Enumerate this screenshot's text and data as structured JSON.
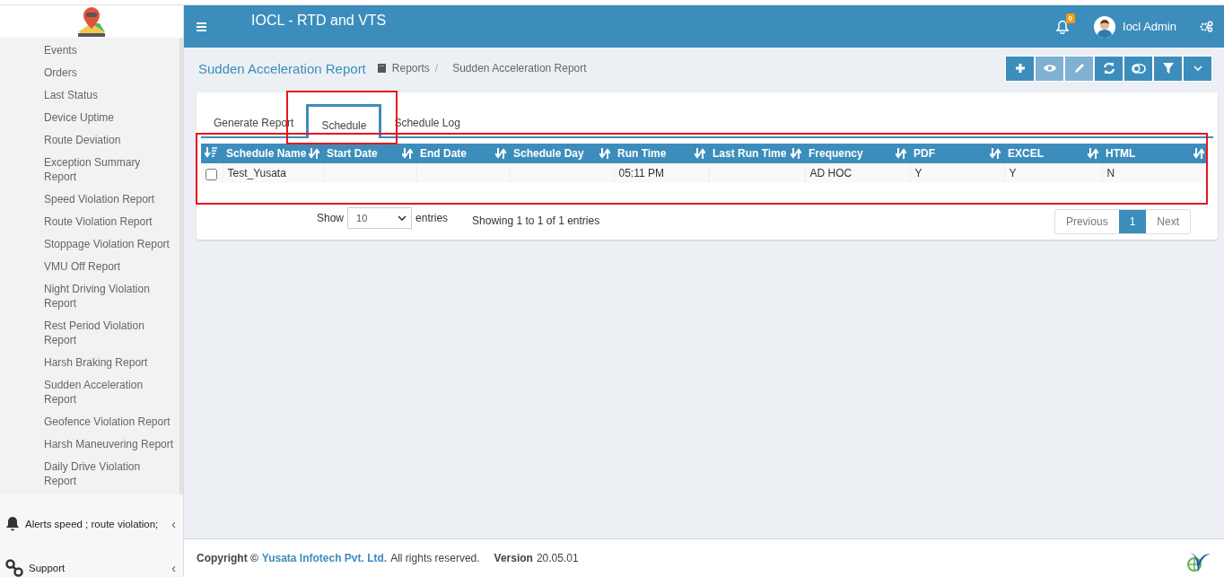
{
  "header": {
    "title": "IOCL - RTD and VTS",
    "notification_count": "0",
    "user_name": "Iocl Admin"
  },
  "sidebar": {
    "items": [
      {
        "label": "Events"
      },
      {
        "label": "Orders"
      },
      {
        "label": "Last Status"
      },
      {
        "label": "Device Uptime"
      },
      {
        "label": "Route Deviation"
      },
      {
        "label": "Exception Summary Report"
      },
      {
        "label": "Speed Violation Report"
      },
      {
        "label": "Route Violation Report"
      },
      {
        "label": "Stoppage Violation Report"
      },
      {
        "label": "VMU Off Report"
      },
      {
        "label": "Night Driving Violation Report"
      },
      {
        "label": "Rest Period Violation Report"
      },
      {
        "label": "Harsh Braking Report"
      },
      {
        "label": "Sudden Acceleration Report"
      },
      {
        "label": "Geofence Violation Report"
      },
      {
        "label": "Harsh Maneuvering Report"
      },
      {
        "label": "Daily Drive Violation Report"
      }
    ],
    "sections": [
      {
        "kind": "bell",
        "label": "Alerts speed ; route violation;",
        "caret": "‹"
      },
      {
        "kind": "link",
        "label": "Support",
        "caret": "‹"
      }
    ]
  },
  "page": {
    "title": "Sudden Acceleration Report",
    "breadcrumbs": [
      "Reports",
      "Sudden Acceleration Report"
    ],
    "separator": "/"
  },
  "toolbar": [
    {
      "kind": "plus",
      "disabled": false
    },
    {
      "kind": "eye",
      "disabled": true
    },
    {
      "kind": "pencil",
      "disabled": true
    },
    {
      "kind": "refresh",
      "disabled": false
    },
    {
      "kind": "toggle",
      "disabled": false
    },
    {
      "kind": "filter",
      "disabled": false
    },
    {
      "kind": "caret",
      "disabled": false
    }
  ],
  "tabs": [
    {
      "label": "Generate Report",
      "selected": false
    },
    {
      "label": "Schedule",
      "selected": true,
      "highlighted": true
    },
    {
      "label": "Schedule Log",
      "selected": false
    }
  ],
  "table": {
    "highlighted": true,
    "columns": [
      "Schedule Name",
      "Start Date",
      "End Date",
      "Schedule Day",
      "Run Time",
      "Last Run Time",
      "Frequency",
      "PDF",
      "EXCEL",
      "HTML"
    ],
    "rows": [
      {
        "checked": false,
        "cells": [
          "Test_Yusata",
          "",
          "",
          "",
          "05:11 PM",
          "",
          "AD HOC",
          "Y",
          "Y",
          "N"
        ]
      }
    ]
  },
  "length_menu": {
    "label": "Show",
    "value": "10",
    "suffix": "entries"
  },
  "info": "Showing 1 to 1 of 1 entries",
  "pagination": [
    {
      "label": "Previous",
      "selected": false
    },
    {
      "label": "1",
      "selected": true
    },
    {
      "label": "Next",
      "selected": false
    }
  ],
  "footer": {
    "copyright": "Copyright ©",
    "company": "Yusata Infotech Pvt. Ltd.",
    "rights": "All rights reserved.",
    "version_label": "Version",
    "version": "20.05.01"
  }
}
